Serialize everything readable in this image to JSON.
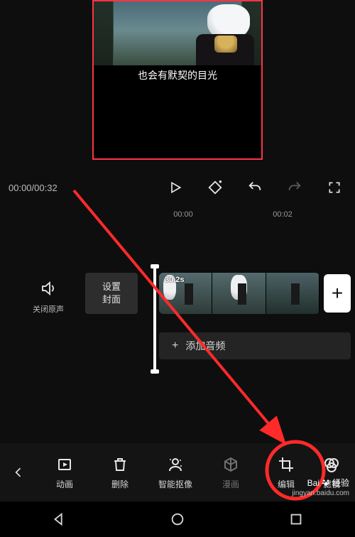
{
  "preview": {
    "subtitle": "也会有默契的目光"
  },
  "transport": {
    "timecode": "00:00/00:32"
  },
  "ruler": {
    "left_label": "00:00",
    "right_label": "00:02"
  },
  "timeline": {
    "mute_label": "关闭原声",
    "cover_button_line1": "设置",
    "cover_button_line2": "封面",
    "clip_duration": "30.2s",
    "add_button": "+",
    "audio_plus": "+",
    "audio_label": "添加音频"
  },
  "toolbar": {
    "back": "‹",
    "items": [
      {
        "key": "animation",
        "label": "动画",
        "dim": false
      },
      {
        "key": "delete",
        "label": "删除",
        "dim": false
      },
      {
        "key": "smart-cutout",
        "label": "智能抠像",
        "dim": false
      },
      {
        "key": "comic",
        "label": "漫画",
        "dim": true
      },
      {
        "key": "edit",
        "label": "编辑",
        "dim": false
      },
      {
        "key": "filter",
        "label": "滤镜",
        "dim": false
      }
    ]
  },
  "watermark": {
    "brand_prefix": "Bai",
    "brand_suffix": "经验",
    "url": "jingyan.baidu.com"
  },
  "annotation": {
    "circle_color": "#ff2a2a"
  }
}
